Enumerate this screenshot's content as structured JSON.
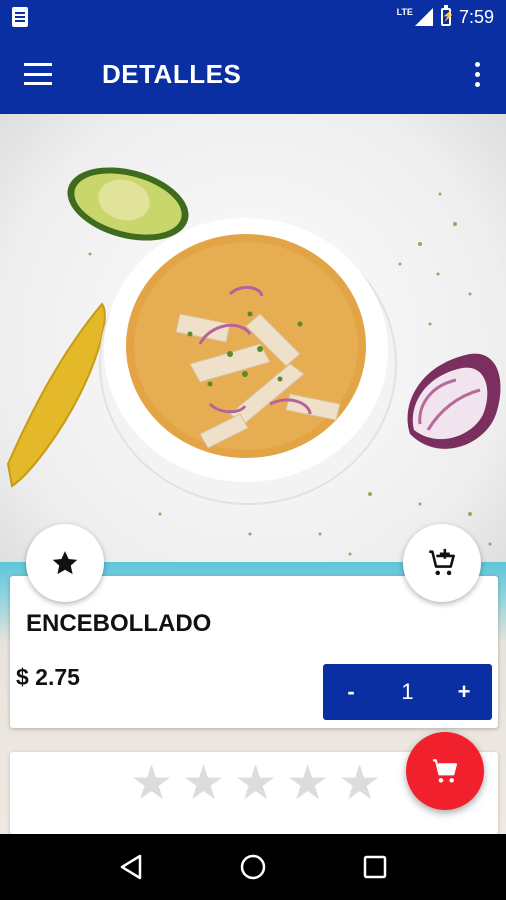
{
  "status_bar": {
    "network": "LTE",
    "time": "7:59",
    "icons": [
      "document-icon",
      "signal-icon",
      "battery-charging-icon"
    ]
  },
  "app_bar": {
    "title": "DETALLES",
    "icons": [
      "menu-icon",
      "more-vert-icon"
    ]
  },
  "product": {
    "name": "ENCEBOLLADO",
    "price": "$ 2.75",
    "quantity": {
      "minus_label": "-",
      "value": "1",
      "plus_label": "+"
    }
  },
  "actions": {
    "favorite_icon": "star-icon",
    "add_to_cart_icon": "cart-add-icon",
    "cart_icon": "shopping-cart-icon"
  },
  "rating": {
    "stars_total": 5,
    "stars_filled": 0
  },
  "navigation": {
    "buttons": [
      "back-icon",
      "home-icon",
      "recents-icon"
    ]
  },
  "colors": {
    "primary": "#0a2fa3",
    "accent": "#f0212d",
    "star_empty": "#dcdcdc"
  }
}
